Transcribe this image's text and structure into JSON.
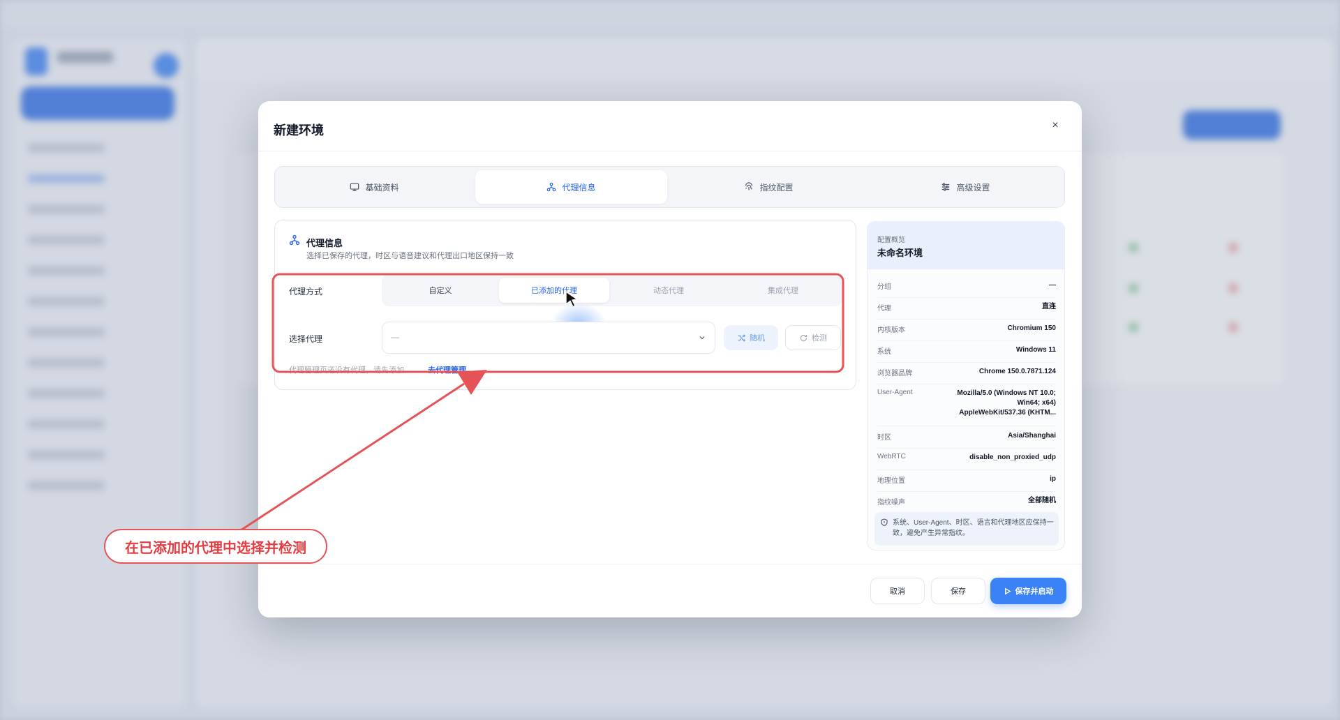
{
  "modal": {
    "title": "新建环境",
    "close": "×",
    "tabs": [
      {
        "label": "基础资料",
        "icon": "monitor-icon"
      },
      {
        "label": "代理信息",
        "icon": "network-icon"
      },
      {
        "label": "指纹配置",
        "icon": "fingerprint-icon"
      },
      {
        "label": "高级设置",
        "icon": "sliders-icon"
      }
    ],
    "active_tab": "代理信息"
  },
  "proxy": {
    "title": "代理信息",
    "subtitle": "选择已保存的代理，时区与语音建议和代理出口地区保持一致",
    "mode_label": "代理方式",
    "modes": [
      "自定义",
      "已添加的代理",
      "动态代理",
      "集成代理"
    ],
    "active_mode": "已添加的代理",
    "select_label": "选择代理",
    "select_value": "—",
    "random_label": "随机",
    "check_label": "检测",
    "hint": "代理管理页还没有代理，请先添加",
    "hint_link": "去代理管理"
  },
  "summary": {
    "kicker": "配置概览",
    "name": "未命名环境",
    "rows": [
      {
        "key": "分组",
        "value": "—"
      },
      {
        "key": "代理",
        "value": "直连"
      },
      {
        "key": "内核版本",
        "value": "Chromium 150"
      },
      {
        "key": "系统",
        "value": "Windows 11"
      },
      {
        "key": "浏览器品牌",
        "value": "Chrome 150.0.7871.124"
      },
      {
        "key": "User-Agent",
        "value": "Mozilla/5.0 (Windows NT 10.0; Win64; x64) AppleWebKit/537.36 (KHTM..."
      },
      {
        "key": "时区",
        "value": "Asia/Shanghai"
      },
      {
        "key": "WebRTC",
        "value": "disable_non_proxied_udp"
      },
      {
        "key": "地理位置",
        "value": "ip"
      },
      {
        "key": "指纹噪声",
        "value": "全部随机"
      }
    ],
    "note": "系统、User-Agent、时区、语言和代理地区应保持一致，避免产生异常指纹。"
  },
  "footer": {
    "cancel": "取消",
    "save": "保存",
    "save_start": "保存并启动"
  },
  "annotation": {
    "callout": "在已添加的代理中选择并检测",
    "color": "#e55357"
  },
  "colors": {
    "accent": "#3b82f6",
    "active_text": "#2563eb"
  }
}
